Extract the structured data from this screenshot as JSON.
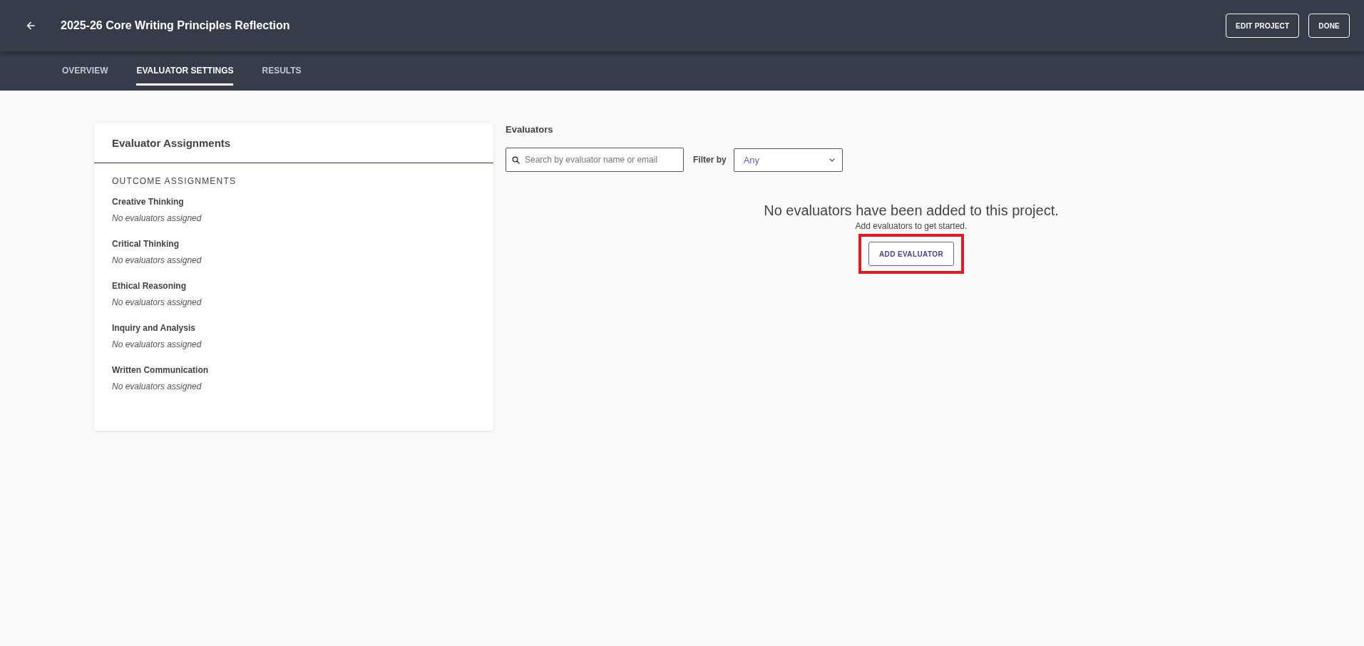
{
  "header": {
    "title": "2025-26 Core Writing Principles Reflection",
    "buttons": [
      "EDIT PROJECT",
      "DONE"
    ]
  },
  "tabs": [
    {
      "label": "OVERVIEW",
      "selected": false
    },
    {
      "label": "EVALUATOR SETTINGS",
      "selected": true
    },
    {
      "label": "RESULTS",
      "selected": false
    }
  ],
  "assignments_card": {
    "title": "Evaluator Assignments",
    "section_heading": "OUTCOME ASSIGNMENTS",
    "outcomes": [
      {
        "name": "Creative Thinking",
        "status": "No evaluators assigned"
      },
      {
        "name": "Critical Thinking",
        "status": "No evaluators assigned"
      },
      {
        "name": "Ethical Reasoning",
        "status": "No evaluators assigned"
      },
      {
        "name": "Inquiry and Analysis",
        "status": "No evaluators assigned"
      },
      {
        "name": "Written Communication",
        "status": "No evaluators assigned"
      }
    ]
  },
  "evaluators": {
    "heading": "Evaluators",
    "search": {
      "placeholder": "Search by evaluator name or email"
    },
    "filter": {
      "label": "Filter by",
      "value": "Any"
    },
    "empty_state": {
      "title": "No evaluators have been added to this project.",
      "subtitle": "Add evaluators to get started.",
      "button": {
        "label": "ADD EVALUATOR",
        "highlighted": true
      }
    }
  }
}
